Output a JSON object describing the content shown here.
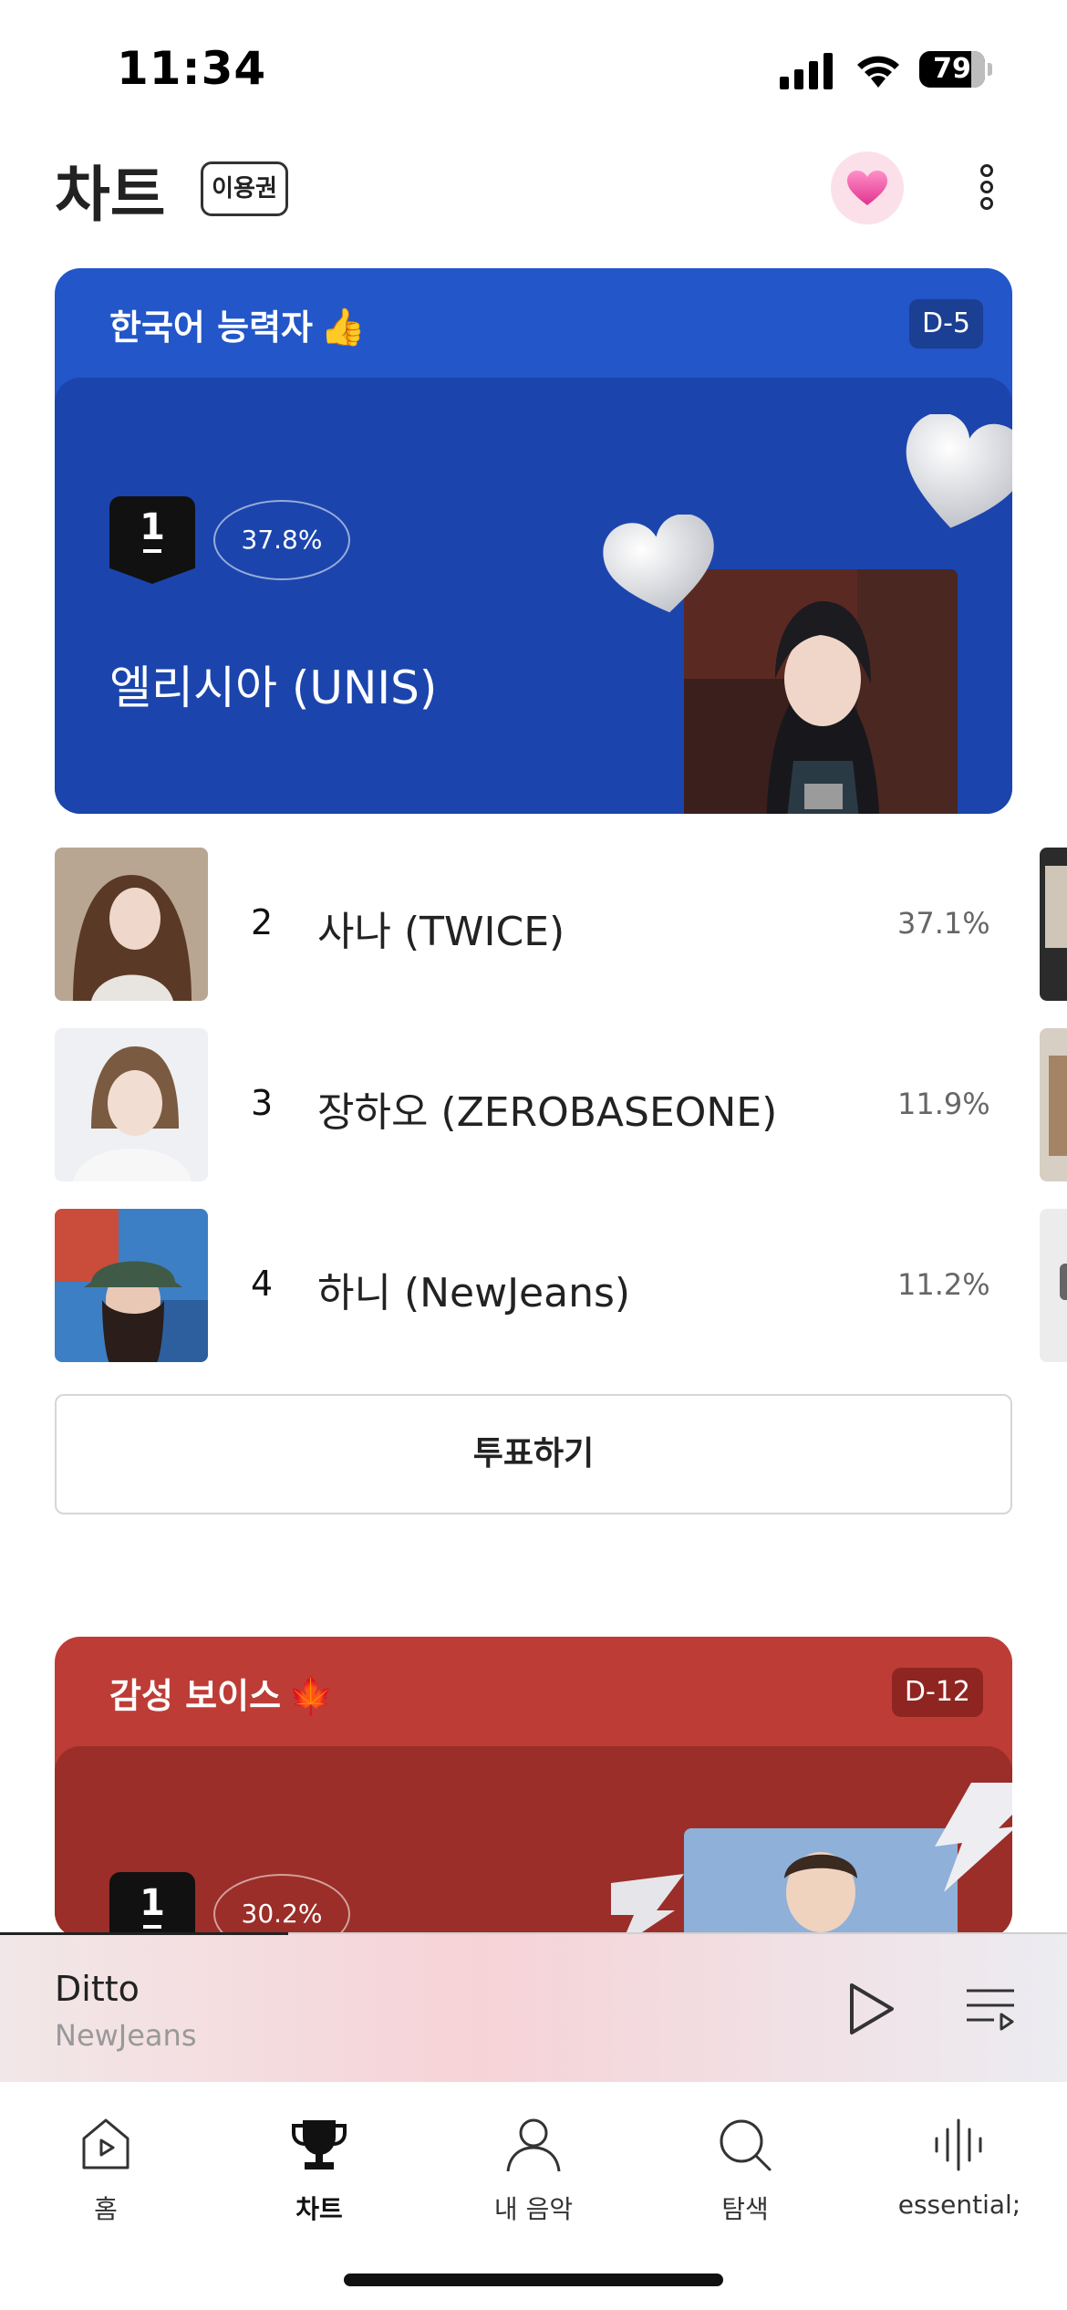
{
  "status_bar": {
    "time": "11:34",
    "battery": "79",
    "battery_level": 0.79
  },
  "header": {
    "title": "차트",
    "pass_label": "이용권"
  },
  "cards": [
    {
      "title": "한국어 능력자",
      "emoji": "👍",
      "dday": "D-5",
      "rank": "1",
      "percent": "37.8%",
      "winner": "엘리시아 (UNIS)",
      "accent": "#2256c9"
    },
    {
      "title": "감성 보이스",
      "emoji": "🍁",
      "dday": "D-12",
      "rank": "1",
      "percent": "30.2%",
      "accent": "#bd3d36"
    }
  ],
  "ranking": [
    {
      "rank": "2",
      "name": "사나 (TWICE)",
      "percent": "37.1%"
    },
    {
      "rank": "3",
      "name": "장하오 (ZEROBASEONE)",
      "percent": "11.9%"
    },
    {
      "rank": "4",
      "name": "하니 (NewJeans)",
      "percent": "11.2%"
    }
  ],
  "vote_button": "투표하기",
  "mini_player": {
    "title": "Ditto",
    "artist": "NewJeans",
    "progress": 0.27
  },
  "tabs": [
    {
      "label": "홈",
      "icon": "home-icon",
      "active": false
    },
    {
      "label": "차트",
      "icon": "trophy-icon",
      "active": true
    },
    {
      "label": "내 음악",
      "icon": "person-icon",
      "active": false
    },
    {
      "label": "탐색",
      "icon": "search-icon",
      "active": false
    },
    {
      "label": "essential;",
      "icon": "soundwave-icon",
      "active": false
    }
  ]
}
